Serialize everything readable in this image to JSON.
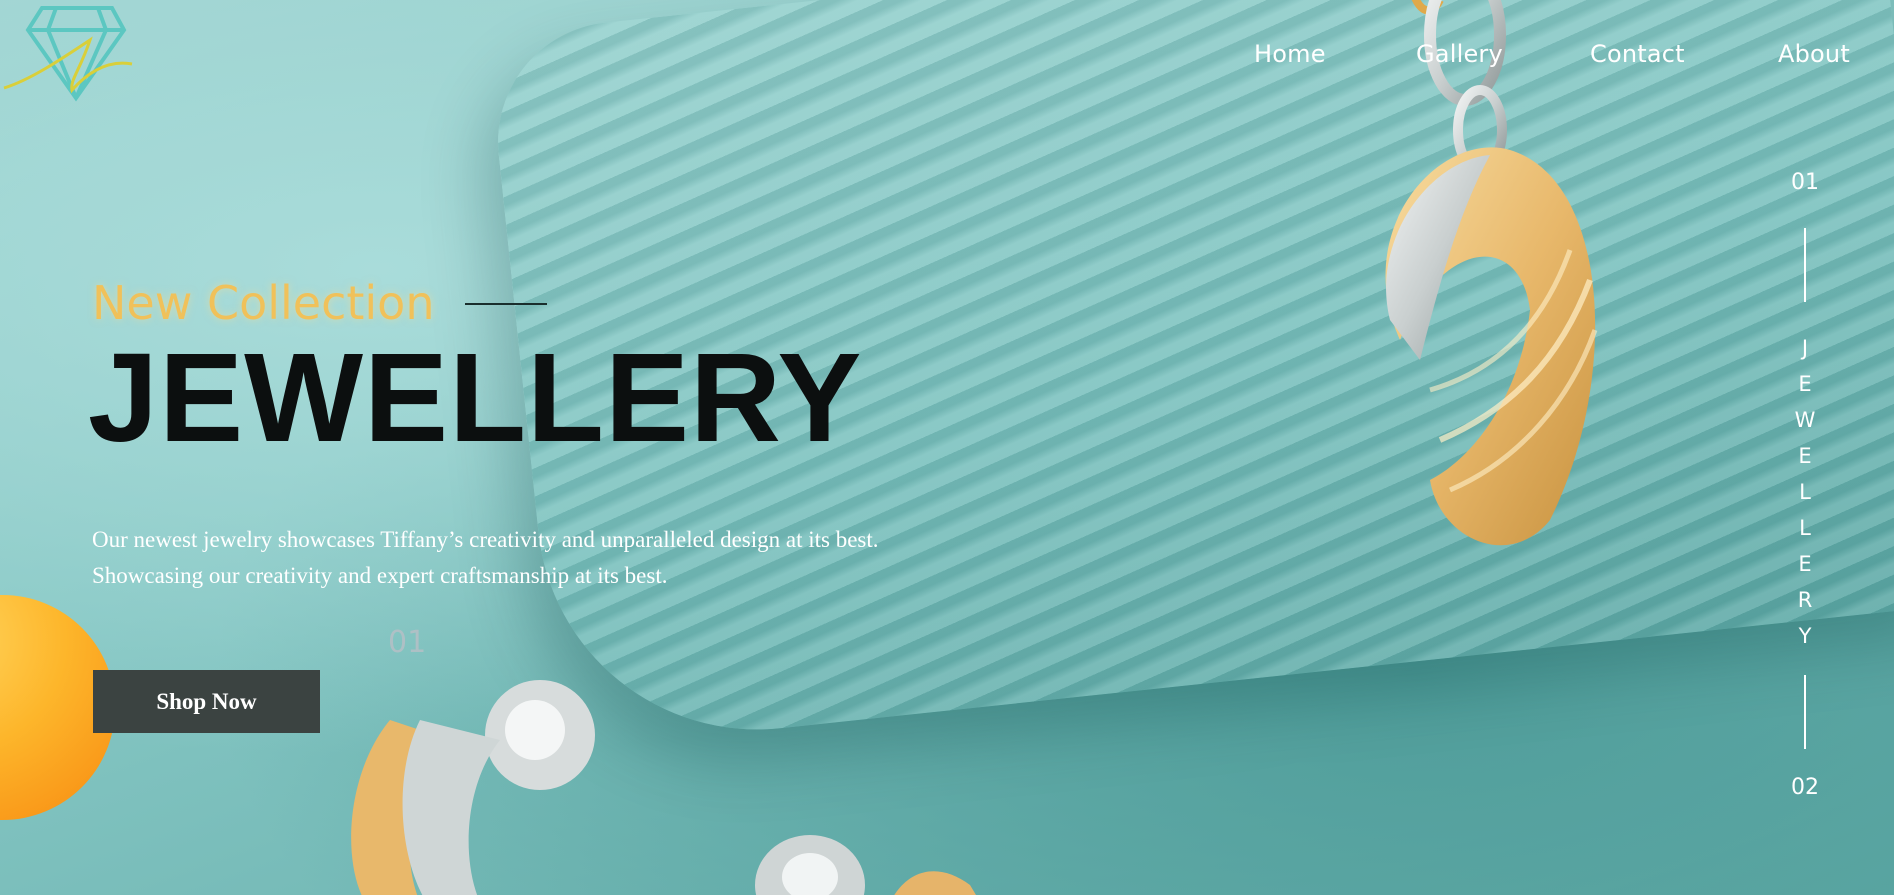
{
  "brand": {
    "logo_icon": "diamond-icon",
    "colors": {
      "accent": "#f0c15a",
      "teal": "#8ecbc8",
      "button": "#3b4341",
      "sun": "#fdb62b"
    }
  },
  "nav": {
    "items": [
      {
        "label": "Home"
      },
      {
        "label": "Gallery"
      },
      {
        "label": "Contact"
      },
      {
        "label": "About"
      }
    ]
  },
  "hero": {
    "eyebrow": "New Collection",
    "title": "JEWELLERY",
    "description_line1": "Our newest jewelry showcases Tiffany’s creativity and unparalleled design at its best.",
    "description_line2": "Showcasing our creativity and expert craftsmanship at its best.",
    "slide_number": "01",
    "button_label": "Shop Now"
  },
  "slider_indicator": {
    "start": "01",
    "end": "02",
    "letters": [
      "J",
      "E",
      "W",
      "E",
      "L",
      "L",
      "E",
      "R",
      "Y"
    ]
  }
}
